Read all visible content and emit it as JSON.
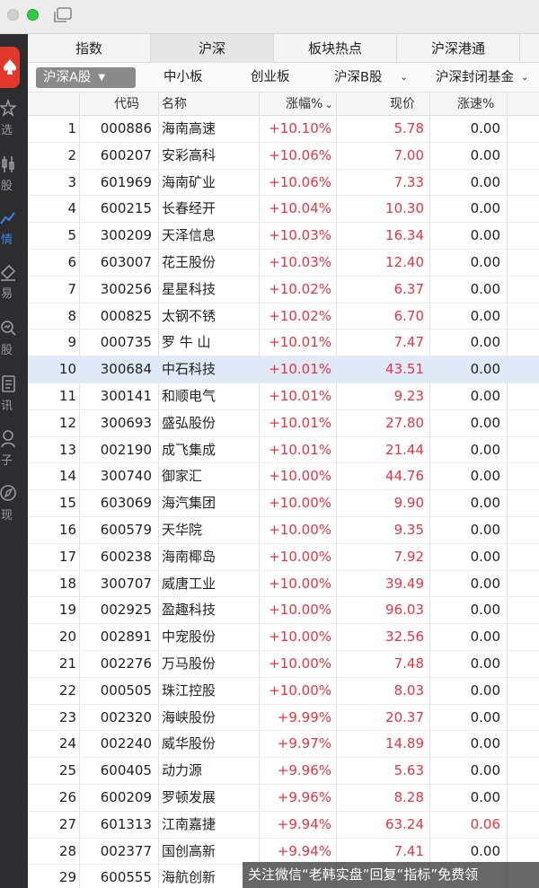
{
  "colors": {
    "up": "#e8343f",
    "accent": "#3b83e6",
    "highlight_row": "#dfe9f8"
  },
  "sidebar": {
    "items": [
      {
        "label": "选",
        "icon": "star-icon"
      },
      {
        "label": "股",
        "icon": "candlestick-icon"
      },
      {
        "label": "情",
        "icon": "trend-line-icon",
        "active": true
      },
      {
        "label": "易",
        "icon": "trade-icon"
      },
      {
        "label": "股",
        "icon": "search-stock-icon"
      },
      {
        "label": "讯",
        "icon": "news-icon"
      },
      {
        "label": "子",
        "icon": "user-icon"
      },
      {
        "label": "现",
        "icon": "compass-icon"
      }
    ]
  },
  "tabs": [
    "指数",
    "沪深",
    "板块热点",
    "沪深港通"
  ],
  "subtabs": {
    "selected": "沪深A股",
    "items": [
      "中小板",
      "创业板",
      "沪深B股",
      "沪深封闭基金"
    ]
  },
  "table": {
    "headers": {
      "code": "代码",
      "name": "名称",
      "pct": "涨幅%",
      "price": "现价",
      "speed": "涨速%"
    },
    "rows": [
      {
        "idx": "1",
        "code": "000886",
        "name": "海南高速",
        "pct": "+10.10%",
        "price": "5.78",
        "speed": "0.00"
      },
      {
        "idx": "2",
        "code": "600207",
        "name": "安彩高科",
        "pct": "+10.06%",
        "price": "7.00",
        "speed": "0.00"
      },
      {
        "idx": "3",
        "code": "601969",
        "name": "海南矿业",
        "pct": "+10.06%",
        "price": "7.33",
        "speed": "0.00"
      },
      {
        "idx": "4",
        "code": "600215",
        "name": "长春经开",
        "pct": "+10.04%",
        "price": "10.30",
        "speed": "0.00"
      },
      {
        "idx": "5",
        "code": "300209",
        "name": "天泽信息",
        "pct": "+10.03%",
        "price": "16.34",
        "speed": "0.00"
      },
      {
        "idx": "6",
        "code": "603007",
        "name": "花王股份",
        "pct": "+10.03%",
        "price": "12.40",
        "speed": "0.00"
      },
      {
        "idx": "7",
        "code": "300256",
        "name": "星星科技",
        "pct": "+10.02%",
        "price": "6.37",
        "speed": "0.00"
      },
      {
        "idx": "8",
        "code": "000825",
        "name": "太钢不锈",
        "pct": "+10.02%",
        "price": "6.70",
        "speed": "0.00"
      },
      {
        "idx": "9",
        "code": "000735",
        "name": "罗 牛 山",
        "pct": "+10.01%",
        "price": "7.47",
        "speed": "0.00"
      },
      {
        "idx": "10",
        "code": "300684",
        "name": "中石科技",
        "pct": "+10.01%",
        "price": "43.51",
        "speed": "0.00",
        "highlight": true
      },
      {
        "idx": "11",
        "code": "300141",
        "name": "和顺电气",
        "pct": "+10.01%",
        "price": "9.23",
        "speed": "0.00"
      },
      {
        "idx": "12",
        "code": "300693",
        "name": "盛弘股份",
        "pct": "+10.01%",
        "price": "27.80",
        "speed": "0.00"
      },
      {
        "idx": "13",
        "code": "002190",
        "name": "成飞集成",
        "pct": "+10.01%",
        "price": "21.44",
        "speed": "0.00"
      },
      {
        "idx": "14",
        "code": "300740",
        "name": "御家汇",
        "pct": "+10.00%",
        "price": "44.76",
        "speed": "0.00"
      },
      {
        "idx": "15",
        "code": "603069",
        "name": "海汽集团",
        "pct": "+10.00%",
        "price": "9.90",
        "speed": "0.00"
      },
      {
        "idx": "16",
        "code": "600579",
        "name": "天华院",
        "pct": "+10.00%",
        "price": "9.35",
        "speed": "0.00"
      },
      {
        "idx": "17",
        "code": "600238",
        "name": "海南椰岛",
        "pct": "+10.00%",
        "price": "7.92",
        "speed": "0.00"
      },
      {
        "idx": "18",
        "code": "300707",
        "name": "威唐工业",
        "pct": "+10.00%",
        "price": "39.49",
        "speed": "0.00"
      },
      {
        "idx": "19",
        "code": "002925",
        "name": "盈趣科技",
        "pct": "+10.00%",
        "price": "96.03",
        "speed": "0.00"
      },
      {
        "idx": "20",
        "code": "002891",
        "name": "中宠股份",
        "pct": "+10.00%",
        "price": "32.56",
        "speed": "0.00"
      },
      {
        "idx": "21",
        "code": "002276",
        "name": "万马股份",
        "pct": "+10.00%",
        "price": "7.48",
        "speed": "0.00"
      },
      {
        "idx": "22",
        "code": "000505",
        "name": "珠江控股",
        "pct": "+10.00%",
        "price": "8.03",
        "speed": "0.00"
      },
      {
        "idx": "23",
        "code": "002320",
        "name": "海峡股份",
        "pct": "+9.99%",
        "price": "20.37",
        "speed": "0.00"
      },
      {
        "idx": "24",
        "code": "002240",
        "name": "威华股份",
        "pct": "+9.97%",
        "price": "14.89",
        "speed": "0.00"
      },
      {
        "idx": "25",
        "code": "600405",
        "name": "动力源",
        "pct": "+9.96%",
        "price": "5.63",
        "speed": "0.00"
      },
      {
        "idx": "26",
        "code": "600209",
        "name": "罗顿发展",
        "pct": "+9.96%",
        "price": "8.28",
        "speed": "0.00"
      },
      {
        "idx": "27",
        "code": "601313",
        "name": "江南嘉捷",
        "pct": "+9.94%",
        "price": "63.24",
        "speed": "0.06",
        "speed_red": true
      },
      {
        "idx": "28",
        "code": "002377",
        "name": "国创高新",
        "pct": "+9.94%",
        "price": "7.41",
        "speed": "0.00"
      },
      {
        "idx": "29",
        "code": "600555",
        "name": "海航创新",
        "pct": "",
        "price": "",
        "speed": ""
      }
    ]
  },
  "watermark": "关注微信“老韩实盘”回复“指标”免费领"
}
